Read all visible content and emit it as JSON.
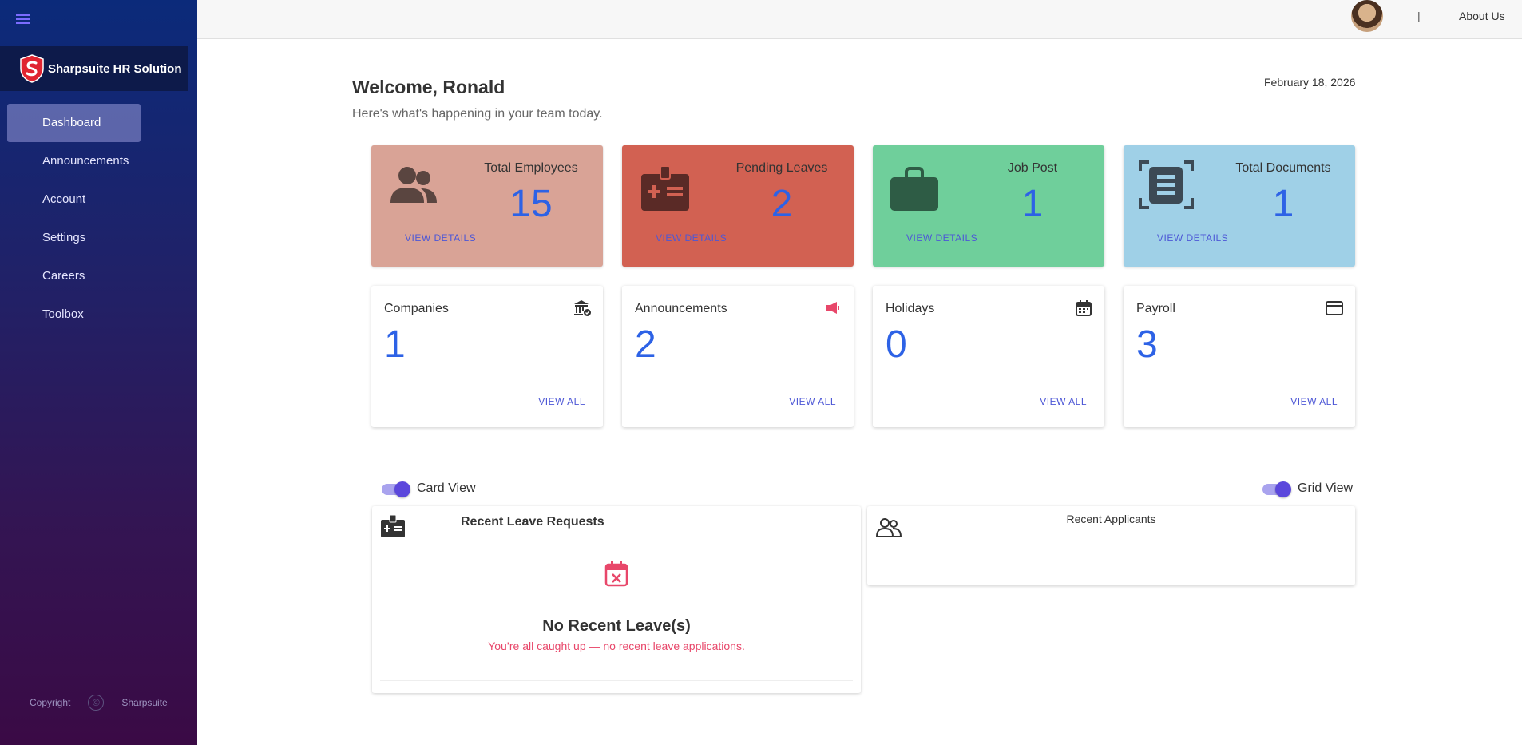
{
  "sidebar": {
    "brand": "Sharpsuite HR Solution",
    "items": [
      {
        "label": "Dashboard"
      },
      {
        "label": "Announcements"
      },
      {
        "label": "Account"
      },
      {
        "label": "Settings"
      },
      {
        "label": "Careers"
      },
      {
        "label": "Toolbox"
      }
    ],
    "copyright_label": "Copyright",
    "copyright_owner": "Sharpsuite"
  },
  "topbar": {
    "separator": "|",
    "about": "About Us"
  },
  "header": {
    "welcome": "Welcome, Ronald",
    "subtitle": "Here's what's happening in your team today.",
    "date": "February 18, 2026"
  },
  "stat_cards": [
    {
      "label": "Total Employees",
      "value": "15",
      "link": "VIEW DETAILS",
      "color": "#d9a396",
      "icon": "people-icon"
    },
    {
      "label": "Pending Leaves",
      "value": "2",
      "link": "VIEW DETAILS",
      "color": "#d26152",
      "icon": "medical-id-icon"
    },
    {
      "label": "Job Post",
      "value": "1",
      "link": "VIEW DETAILS",
      "color": "#6fcf9b",
      "icon": "briefcase-icon"
    },
    {
      "label": "Total Documents",
      "value": "1",
      "link": "VIEW DETAILS",
      "color": "#9fd0e7",
      "icon": "document-scan-icon"
    }
  ],
  "summary_cards": [
    {
      "label": "Companies",
      "value": "1",
      "link": "VIEW ALL",
      "icon": "bank-check-icon"
    },
    {
      "label": "Announcements",
      "value": "2",
      "link": "VIEW ALL",
      "icon": "megaphone-icon"
    },
    {
      "label": "Holidays",
      "value": "0",
      "link": "VIEW ALL",
      "icon": "calendar-icon"
    },
    {
      "label": "Payroll",
      "value": "3",
      "link": "VIEW ALL",
      "icon": "credit-card-icon"
    }
  ],
  "toggles": {
    "card_view": "Card View",
    "grid_view": "Grid View"
  },
  "recent_leave": {
    "title": "Recent Leave Requests",
    "empty_title": "No Recent Leave(s)",
    "empty_sub": "You’re all caught up — no recent leave applications."
  },
  "recent_applicants": {
    "title": "Recent Applicants"
  },
  "colors": {
    "accent": "#5b47dc",
    "value_blue": "#2d62e6",
    "link": "#4d57d6"
  }
}
